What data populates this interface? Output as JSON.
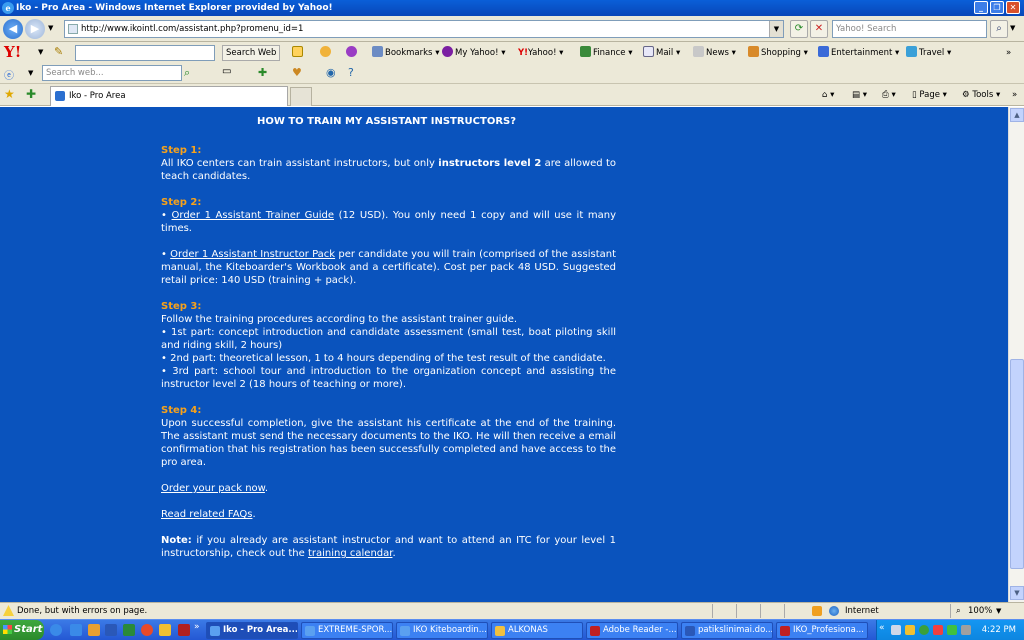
{
  "window": {
    "title": "Iko - Pro Area - Windows Internet Explorer provided by Yahoo!",
    "controls": [
      "_",
      "❐",
      "✕"
    ]
  },
  "address": {
    "url": "http://www.ikointl.com/assistant.php?promenu_id=1",
    "search_placeholder": "Yahoo! Search"
  },
  "yahoo_toolbar": {
    "search_button": "Search Web",
    "items": [
      "Bookmarks",
      "My Yahoo!",
      "Yahoo!",
      "Finance",
      "Mail",
      "News",
      "Shopping",
      "Entertainment",
      "Travel"
    ],
    "search_web_placeholder": "Search web..."
  },
  "tabs": {
    "active_label": "Iko - Pro Area"
  },
  "command_bar": {
    "page": "Page",
    "tools": "Tools"
  },
  "article": {
    "heading": "HOW TO TRAIN MY ASSISTANT INSTRUCTORS?",
    "step1": {
      "title": "Step 1:",
      "text_a": "All IKO centers can train assistant instructors, but only ",
      "bold": "instructors level 2",
      "text_b": " are allowed to teach candidates."
    },
    "step2": {
      "title": "Step 2:",
      "bullet": "• ",
      "link1": "Order 1 Assistant Trainer Guide",
      "text1": " (12 USD). You only need 1 copy and will use it many times.",
      "link2": "Order 1 Assistant Instructor Pack",
      "text2": " per candidate you will train (comprised of the assistant manual, the Kiteboarder's Workbook and a certificate). Cost per pack 48 USD. Suggested retail price: 140 USD (training + pack)."
    },
    "step3": {
      "title": "Step 3:",
      "intro": "Follow the training procedures according to the assistant trainer guide.",
      "b1": "• 1st part: concept introduction and candidate assessment (small test, boat piloting skill and riding skill, 2 hours)",
      "b2": "• 2nd part: theoretical lesson, 1 to 4 hours depending of the test result of the candidate.",
      "b3": "• 3rd part: school tour and introduction to the organization concept and assisting the instructor level 2 (18 hours of teaching or more)."
    },
    "step4": {
      "title": "Step 4:",
      "text": "Upon successful completion, give the assistant his certificate at the end of the training. The assistant must send the necessary documents to the IKO. He will then receive a email confirmation that his registration has been successfully completed and have access to the pro area."
    },
    "order_link": "Order your pack now",
    "period": ".",
    "faq_link": "Read related FAQs",
    "note": {
      "label": "Note:",
      "text": " if you already are assistant instructor and want to attend an ITC for your level 1 instructorship, check out the ",
      "link": "training calendar",
      "end": "."
    }
  },
  "status": {
    "text": "Done, but with errors on page.",
    "zone": "Internet",
    "zoom": "100%"
  },
  "taskbar": {
    "start": "Start",
    "buttons": [
      "Iko - Pro Area...",
      "EXTREME-SPOR...",
      "IKO Kiteboardin...",
      "ALKONAS",
      "Adobe Reader -...",
      "patikslinimai.do...",
      "IKO_Profesiona..."
    ],
    "clock": "4:22 PM"
  }
}
